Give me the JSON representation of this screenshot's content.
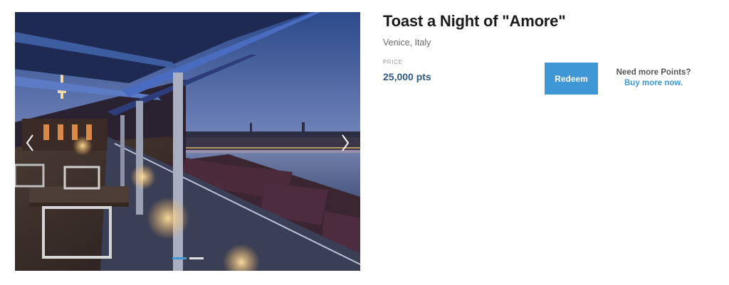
{
  "listing": {
    "title": "Toast a Night of \"Amore\"",
    "location": "Venice, Italy"
  },
  "price": {
    "label": "PRICE",
    "value": "25,000 pts"
  },
  "actions": {
    "redeem_label": "Redeem",
    "more_points_question": "Need more Points?",
    "buy_more_link": "Buy more now."
  },
  "carousel": {
    "prev_icon": "chevron-left-icon",
    "next_icon": "chevron-right-icon",
    "slide_count": 2,
    "active_slide": 1
  },
  "colors": {
    "accent": "#3f97d6",
    "price_text": "#2e5a8a",
    "title_text": "#1b1b1b"
  }
}
